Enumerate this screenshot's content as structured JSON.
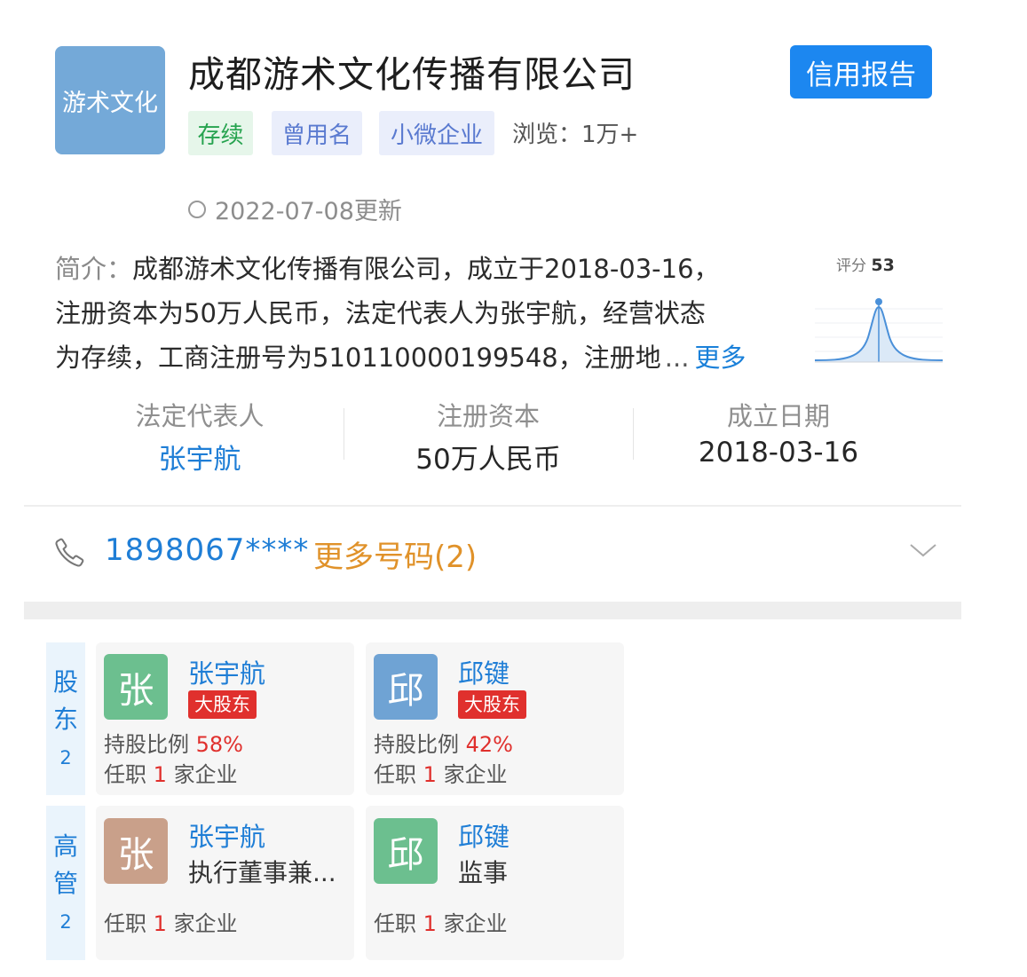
{
  "header": {
    "logo_text": "游术文化",
    "company_name": "成都游术文化传播有限公司",
    "report_button": "信用报告",
    "tags": {
      "status": "存续",
      "former_name": "曾用名",
      "size": "小微企业"
    },
    "views": "浏览：1万+",
    "updated": "2022-07-08更新"
  },
  "intro": {
    "label": "简介：",
    "line1": "成都游术文化传播有限公司，成立于2018-03-16，",
    "line2": "注册资本为50万人民币，法定代表人为张宇航，经营状态",
    "line3": "为存续，工商注册号为510110000199548，注册地",
    "ellipsis": "...",
    "more": "更多"
  },
  "score": {
    "label": "评分",
    "value": "53"
  },
  "key_info": {
    "legal_rep_label": "法定代表人",
    "legal_rep": "张宇航",
    "capital_label": "注册资本",
    "capital": "50万人民币",
    "founded_label": "成立日期",
    "founded": "2018-03-16"
  },
  "phone": {
    "number": "1898067****",
    "more": "更多号码(2)"
  },
  "shareholders": {
    "tab_chars": [
      "股",
      "东"
    ],
    "count": "2",
    "items": [
      {
        "avatar": "张",
        "name": "张宇航",
        "badge": "大股东",
        "ratio_label": "持股比例",
        "ratio": "58%",
        "job_prefix": "任职",
        "job_count": "1",
        "job_suffix": "家企业"
      },
      {
        "avatar": "邱",
        "name": "邱键",
        "badge": "大股东",
        "ratio_label": "持股比例",
        "ratio": "42%",
        "job_prefix": "任职",
        "job_count": "1",
        "job_suffix": "家企业"
      }
    ]
  },
  "executives": {
    "tab_chars": [
      "高",
      "管"
    ],
    "count": "2",
    "items": [
      {
        "avatar": "张",
        "name": "张宇航",
        "role": "执行董事兼...",
        "job_prefix": "任职",
        "job_count": "1",
        "job_suffix": "家企业"
      },
      {
        "avatar": "邱",
        "name": "邱键",
        "role": "监事",
        "job_prefix": "任职",
        "job_count": "1",
        "job_suffix": "家企业"
      }
    ]
  },
  "colors": {
    "accent_blue": "#1f7ed6",
    "report_button": "#1c87f0",
    "logo_bg": "#74a9d8",
    "phone_more": "#e0922a",
    "badge_red": "#e0302d",
    "avatar_green": "#6cbf8f",
    "avatar_blue": "#6fa3d4",
    "avatar_brown": "#c9a08a"
  },
  "icons": {
    "phone": "phone-icon",
    "chevron": "chevron-down-icon",
    "refresh": "refresh-icon"
  }
}
